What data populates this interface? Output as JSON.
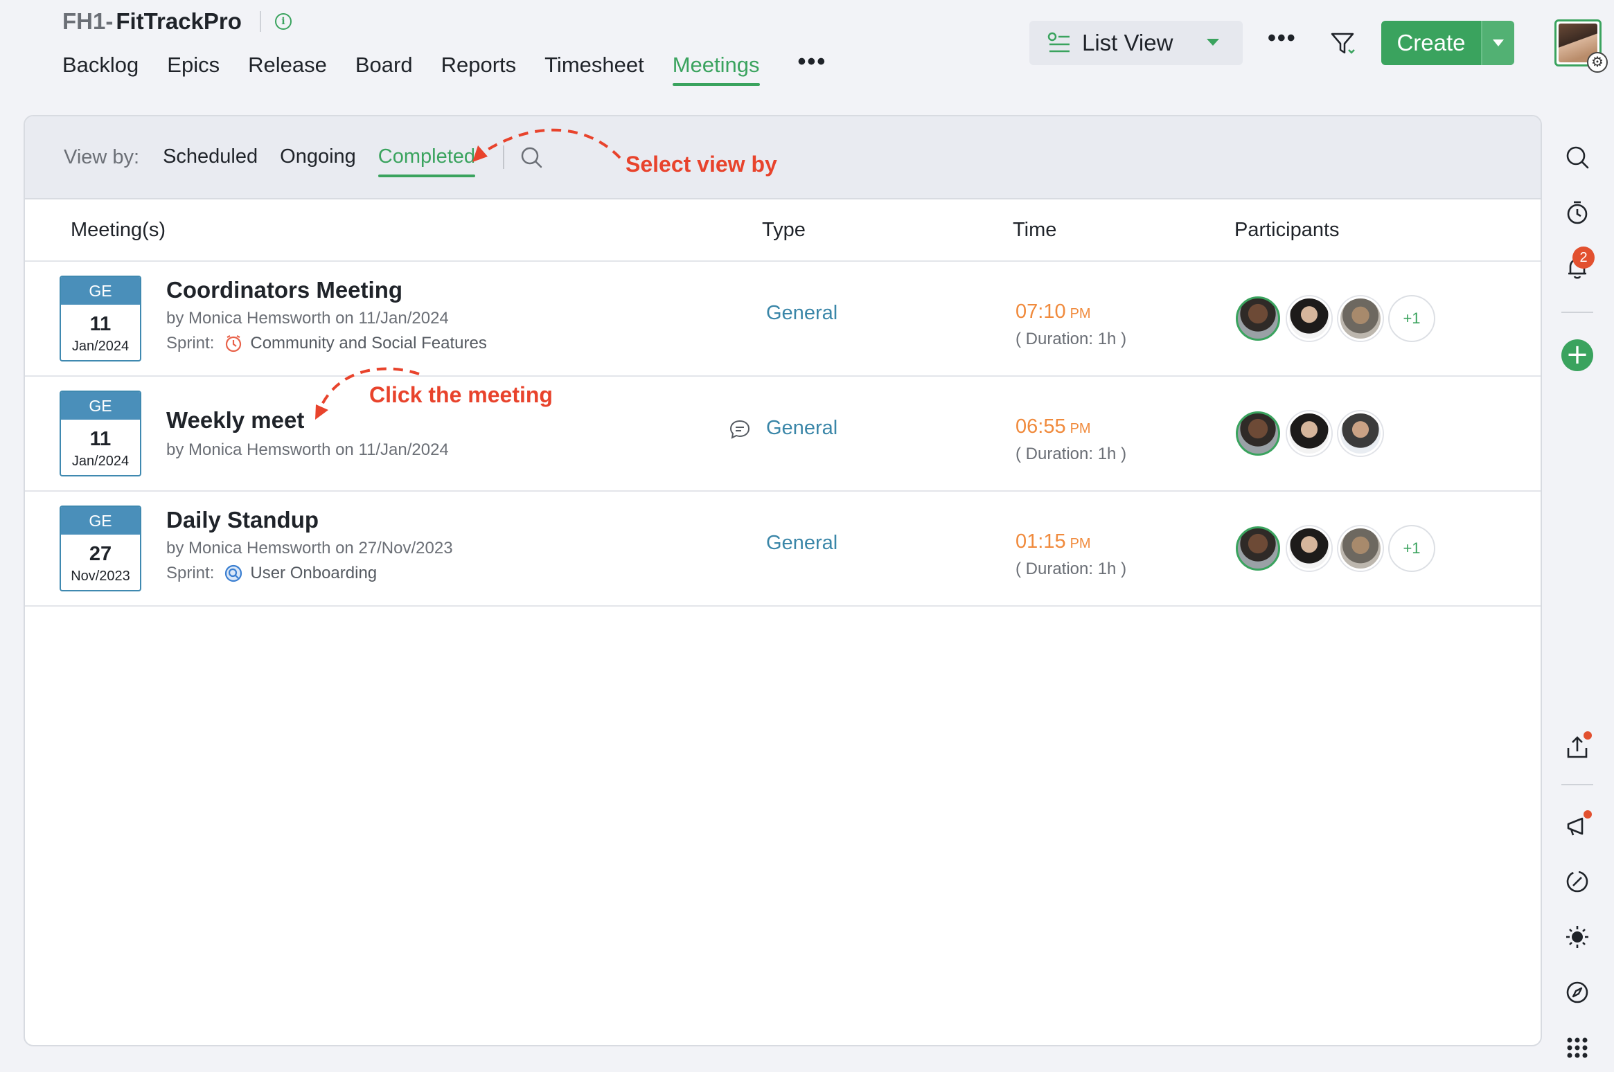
{
  "project": {
    "code": "FH1-",
    "name": "FitTrackPro"
  },
  "nav": {
    "tabs": [
      {
        "label": "Backlog"
      },
      {
        "label": "Epics"
      },
      {
        "label": "Release"
      },
      {
        "label": "Board"
      },
      {
        "label": "Reports"
      },
      {
        "label": "Timesheet"
      },
      {
        "label": "Meetings",
        "active": true
      }
    ],
    "more": "•••"
  },
  "toolbar": {
    "view_label": "List View",
    "more": "•••",
    "create_label": "Create"
  },
  "viewby": {
    "label": "View by:",
    "options": [
      "Scheduled",
      "Ongoing",
      "Completed"
    ],
    "active": "Completed"
  },
  "table": {
    "headers": {
      "meetings": "Meeting(s)",
      "type": "Type",
      "time": "Time",
      "participants": "Participants"
    },
    "rows": [
      {
        "date_type": "GE",
        "day": "11",
        "month_year": "Jan/2024",
        "title": "Coordinators Meeting",
        "by": "by Monica Hemsworth on 11/Jan/2024",
        "sprint_label": "Sprint:",
        "sprint": "Community and Social Features",
        "type": "General",
        "time": "07:10",
        "ampm": "PM",
        "duration": "( Duration: 1h )",
        "more_participants": "+1"
      },
      {
        "date_type": "GE",
        "day": "11",
        "month_year": "Jan/2024",
        "title": "Weekly meet",
        "by": "by Monica Hemsworth on 11/Jan/2024",
        "type": "General",
        "time": "06:55",
        "ampm": "PM",
        "duration": "( Duration: 1h )"
      },
      {
        "date_type": "GE",
        "day": "27",
        "month_year": "Nov/2023",
        "title": "Daily Standup",
        "by": "by Monica Hemsworth on 27/Nov/2023",
        "sprint_label": "Sprint:",
        "sprint": "User Onboarding",
        "type": "General",
        "time": "01:15",
        "ampm": "PM",
        "duration": "( Duration: 1h )",
        "more_participants": "+1"
      }
    ]
  },
  "annotations": {
    "select_view": "Select view by",
    "click_meeting": "Click the meeting"
  },
  "rail": {
    "notification_count": "2"
  },
  "colors": {
    "accent": "#3aa35e",
    "link": "#3a86a8",
    "time": "#f08a3c",
    "annotation": "#e8432c",
    "date_header": "#4a8fba"
  }
}
